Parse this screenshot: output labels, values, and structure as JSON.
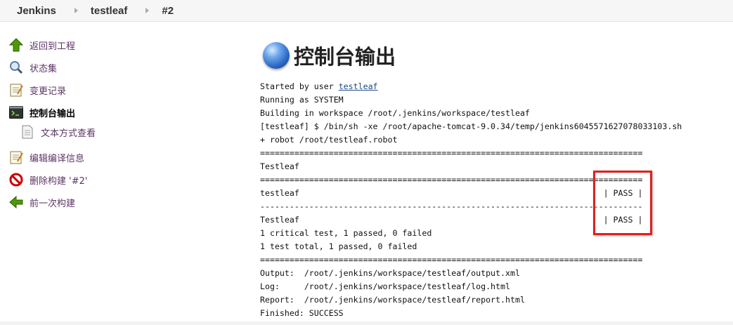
{
  "breadcrumb": {
    "items": [
      "Jenkins",
      "testleaf",
      "#2"
    ]
  },
  "side_panel": {
    "tasks": [
      {
        "label": "返回到工程",
        "icon": "up-arrow-icon"
      },
      {
        "label": "状态集",
        "icon": "magnifier-icon"
      },
      {
        "label": "变更记录",
        "icon": "notepad-icon"
      },
      {
        "label": "控制台输出",
        "icon": "terminal-icon",
        "active": true
      },
      {
        "label": "文本方式查看",
        "icon": "document-icon"
      },
      {
        "label": "编辑编译信息",
        "icon": "notepad-icon"
      },
      {
        "label": "删除构建 '#2'",
        "icon": "no-entry-icon"
      },
      {
        "label": "前一次构建",
        "icon": "left-arrow-icon"
      }
    ]
  },
  "main": {
    "title": "控制台输出",
    "console": {
      "started_prefix": "Started by user ",
      "started_user": "testleaf",
      "lines": [
        "Running as SYSTEM",
        "Building in workspace /root/.jenkins/workspace/testleaf",
        "[testleaf] $ /bin/sh -xe /root/apache-tomcat-9.0.34/temp/jenkins6045571627078033103.sh",
        "+ robot /root/testleaf.robot",
        "==============================================================================",
        "Testleaf",
        "==============================================================================",
        "testleaf                                                              | PASS |",
        "------------------------------------------------------------------------------",
        "Testleaf                                                              | PASS |",
        "1 critical test, 1 passed, 0 failed",
        "1 test total, 1 passed, 0 failed",
        "==============================================================================",
        "Output:  /root/.jenkins/workspace/testleaf/output.xml",
        "Log:     /root/.jenkins/workspace/testleaf/log.html",
        "Report:  /root/.jenkins/workspace/testleaf/report.html",
        "Finished: SUCCESS"
      ]
    }
  },
  "colors": {
    "link_purple": "#5c3566",
    "highlight_red": "#e02020",
    "globe_blue": "#2b66c3"
  }
}
